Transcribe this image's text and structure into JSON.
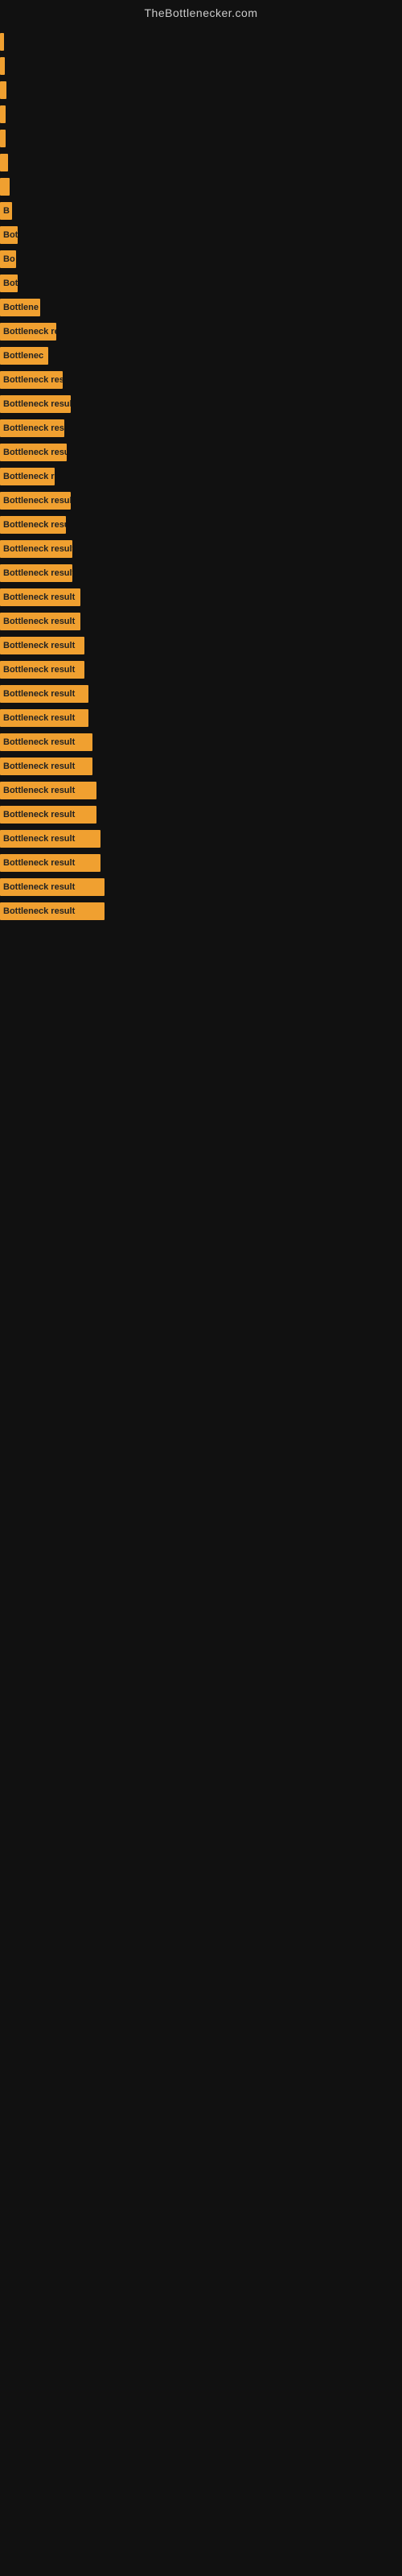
{
  "site": {
    "title": "TheBottlenecker.com"
  },
  "bars": [
    {
      "width": 5,
      "label": ""
    },
    {
      "width": 6,
      "label": ""
    },
    {
      "width": 8,
      "label": ""
    },
    {
      "width": 7,
      "label": ""
    },
    {
      "width": 7,
      "label": ""
    },
    {
      "width": 10,
      "label": ""
    },
    {
      "width": 12,
      "label": ""
    },
    {
      "width": 15,
      "label": "B"
    },
    {
      "width": 22,
      "label": "Bot"
    },
    {
      "width": 20,
      "label": "Bo"
    },
    {
      "width": 22,
      "label": "Bot"
    },
    {
      "width": 50,
      "label": "Bottlene"
    },
    {
      "width": 70,
      "label": "Bottleneck re"
    },
    {
      "width": 60,
      "label": "Bottlenec"
    },
    {
      "width": 78,
      "label": "Bottleneck res"
    },
    {
      "width": 88,
      "label": "Bottleneck result"
    },
    {
      "width": 80,
      "label": "Bottleneck res"
    },
    {
      "width": 83,
      "label": "Bottleneck resul"
    },
    {
      "width": 68,
      "label": "Bottleneck r"
    },
    {
      "width": 88,
      "label": "Bottleneck result"
    },
    {
      "width": 82,
      "label": "Bottleneck resu"
    },
    {
      "width": 90,
      "label": "Bottleneck result"
    },
    {
      "width": 90,
      "label": "Bottleneck result"
    },
    {
      "width": 100,
      "label": "Bottleneck result"
    },
    {
      "width": 100,
      "label": "Bottleneck result"
    },
    {
      "width": 105,
      "label": "Bottleneck result"
    },
    {
      "width": 105,
      "label": "Bottleneck result"
    },
    {
      "width": 110,
      "label": "Bottleneck result"
    },
    {
      "width": 110,
      "label": "Bottleneck result"
    },
    {
      "width": 115,
      "label": "Bottleneck result"
    },
    {
      "width": 115,
      "label": "Bottleneck result"
    },
    {
      "width": 120,
      "label": "Bottleneck result"
    },
    {
      "width": 120,
      "label": "Bottleneck result"
    },
    {
      "width": 125,
      "label": "Bottleneck result"
    },
    {
      "width": 125,
      "label": "Bottleneck result"
    },
    {
      "width": 130,
      "label": "Bottleneck result"
    },
    {
      "width": 130,
      "label": "Bottleneck result"
    }
  ]
}
